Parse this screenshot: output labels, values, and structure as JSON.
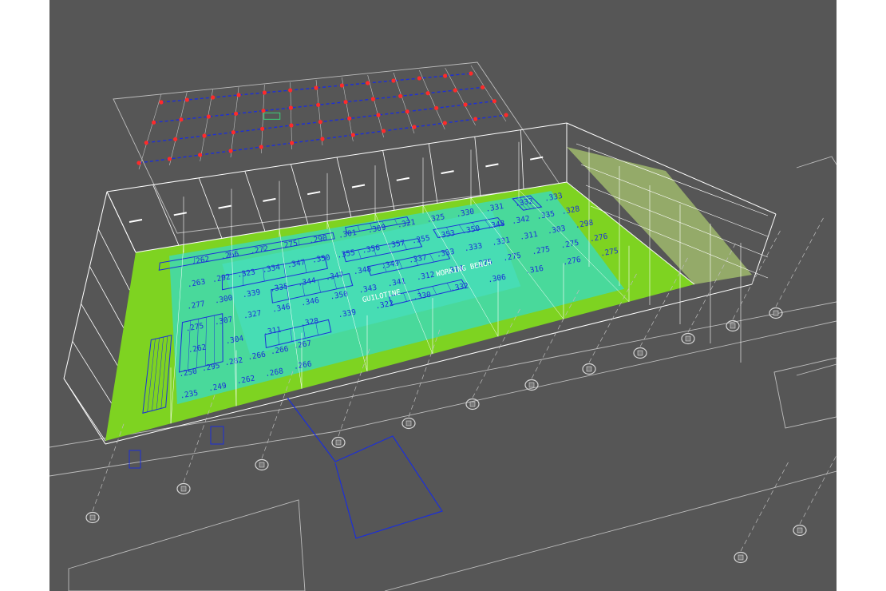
{
  "colors": {
    "background": "#565656",
    "floor_fill": "#7ed321",
    "heatmap_cyan": "#3fd9b0",
    "wireframe": "#ffffff",
    "cad_blue": "#1c2fd8",
    "grid_red": "#ff2a2a",
    "drawing_line": "#bdbdbd"
  },
  "view": {
    "mode": "3D isometric wireframe",
    "content": "warehouse model with illuminance heatmap"
  },
  "floor_labels": {
    "row1": [
      ".262",
      ".266",
      ".272",
      ".275",
      ".290",
      ".301",
      ".309",
      ".321",
      ".325",
      ".330",
      ".331",
      ".332",
      ".333"
    ],
    "row2": [
      ".263",
      ".292",
      ".323",
      ".334",
      ".347",
      ".350",
      ".355",
      ".356",
      ".357",
      ".355",
      ".353",
      ".350",
      ".348",
      ".342",
      ".335",
      ".328"
    ],
    "row3": [
      ".277",
      ".300",
      ".339",
      ".335",
      ".344",
      ".347",
      ".348",
      ".349",
      ".337",
      ".333",
      ".333",
      ".331",
      ".311",
      ".303",
      ".298"
    ],
    "row4": [
      ".275",
      ".307",
      ".327",
      ".346",
      ".346",
      ".350",
      ".343",
      ".341",
      ".312",
      ".314",
      ".275",
      ".275",
      ".275",
      ".275",
      ".276"
    ],
    "row5": [
      ".262",
      ".304",
      ".311",
      ".328",
      ".339",
      ".322",
      ".330",
      ".332",
      ".306",
      ".316",
      ".276",
      ".275"
    ],
    "row6": [
      ".250",
      ".295",
      ".282",
      ".266",
      ".266",
      ".267"
    ],
    "row7": [
      ".235",
      ".249",
      ".262",
      ".268",
      ".266"
    ]
  },
  "area_labels": {
    "guillotine": "GUILOTINE",
    "working_bench": "WORKING BENCH"
  }
}
